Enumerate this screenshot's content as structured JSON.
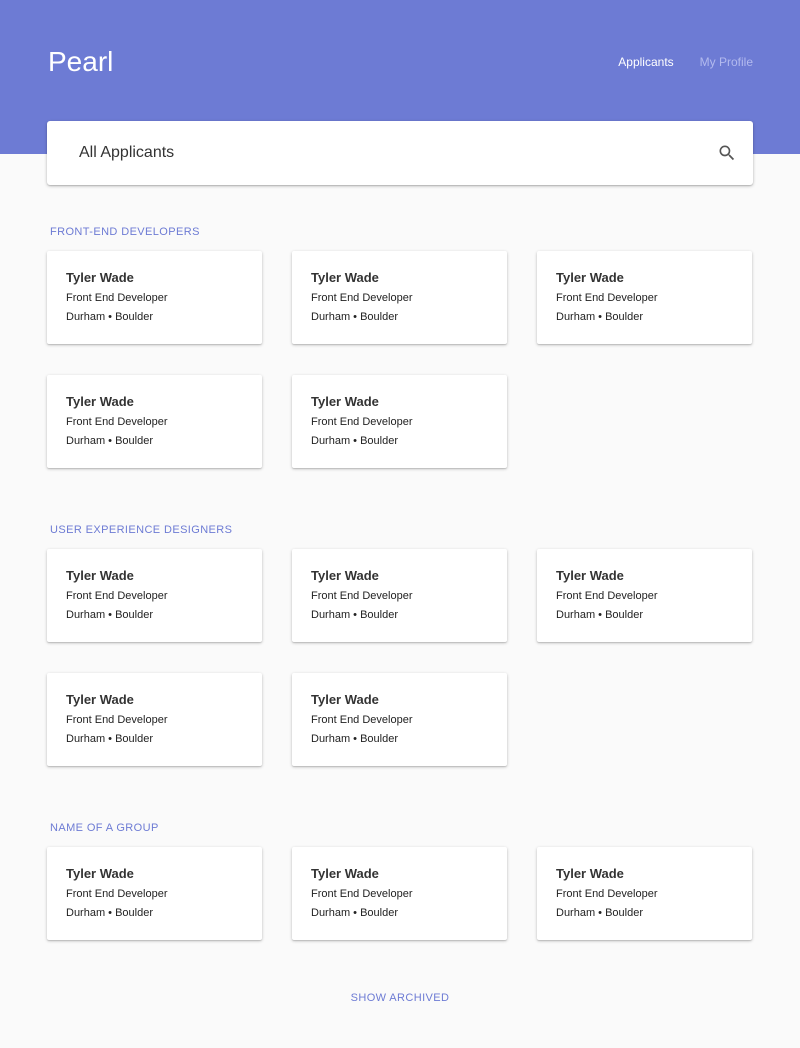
{
  "header": {
    "brand": "Pearl",
    "nav": [
      {
        "label": "Applicants",
        "active": true
      },
      {
        "label": "My Profile",
        "active": false
      }
    ]
  },
  "search": {
    "title": "All Applicants",
    "icon": "search-icon"
  },
  "groups": [
    {
      "title": "FRONT-END DEVELOPERS",
      "cards": [
        {
          "name": "Tyler Wade",
          "role": "Front End Developer",
          "location": "Durham • Boulder"
        },
        {
          "name": "Tyler Wade",
          "role": "Front End Developer",
          "location": "Durham • Boulder"
        },
        {
          "name": "Tyler Wade",
          "role": "Front End Developer",
          "location": "Durham • Boulder"
        },
        {
          "name": "Tyler Wade",
          "role": "Front End Developer",
          "location": "Durham • Boulder"
        },
        {
          "name": "Tyler Wade",
          "role": "Front End Developer",
          "location": "Durham • Boulder"
        }
      ]
    },
    {
      "title": "USER EXPERIENCE DESIGNERS",
      "cards": [
        {
          "name": "Tyler Wade",
          "role": "Front End Developer",
          "location": "Durham • Boulder"
        },
        {
          "name": "Tyler Wade",
          "role": "Front End Developer",
          "location": "Durham • Boulder"
        },
        {
          "name": "Tyler Wade",
          "role": "Front End Developer",
          "location": "Durham • Boulder"
        },
        {
          "name": "Tyler Wade",
          "role": "Front End Developer",
          "location": "Durham • Boulder"
        },
        {
          "name": "Tyler Wade",
          "role": "Front End Developer",
          "location": "Durham • Boulder"
        }
      ]
    },
    {
      "title": "NAME OF A GROUP",
      "cards": [
        {
          "name": "Tyler Wade",
          "role": "Front End Developer",
          "location": "Durham • Boulder"
        },
        {
          "name": "Tyler Wade",
          "role": "Front End Developer",
          "location": "Durham • Boulder"
        },
        {
          "name": "Tyler Wade",
          "role": "Front End Developer",
          "location": "Durham • Boulder"
        }
      ]
    }
  ],
  "footer": {
    "show_archived": "SHOW ARCHIVED"
  },
  "colors": {
    "accent": "#6d7bd4",
    "background": "#fafafa",
    "card": "#ffffff",
    "nav_inactive": "#b3baee"
  }
}
